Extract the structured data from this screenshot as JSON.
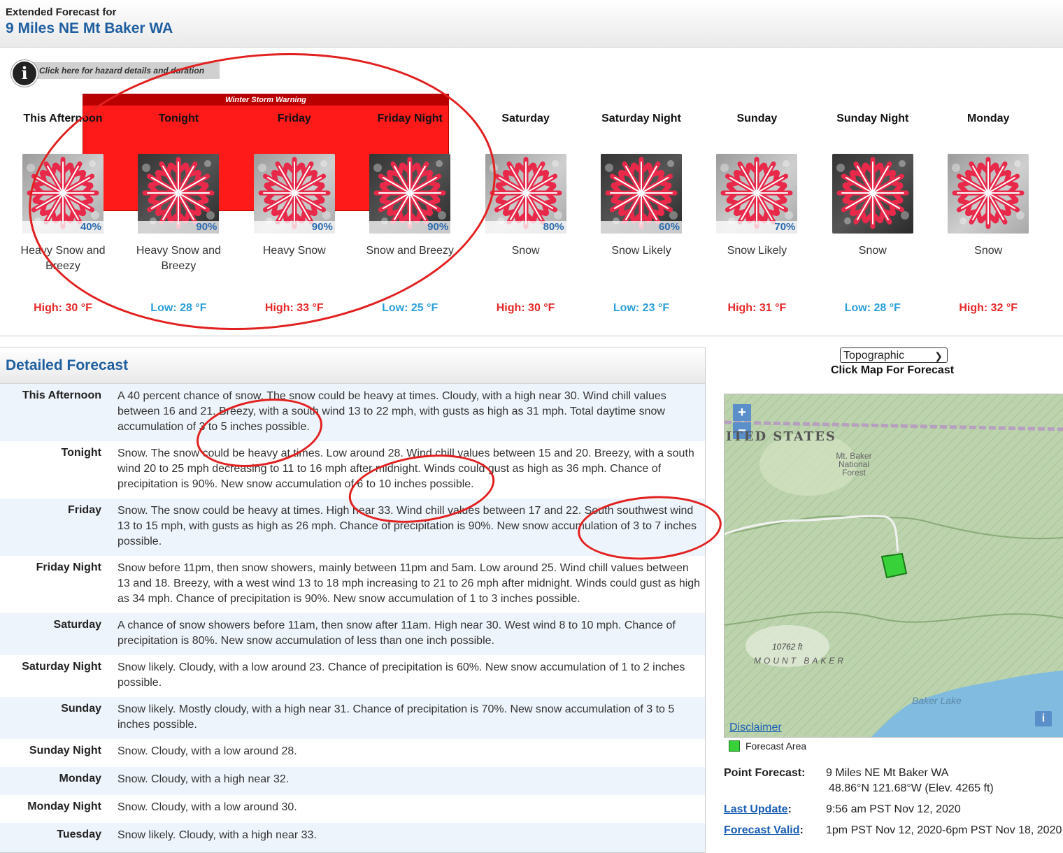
{
  "header": {
    "line1": "Extended Forecast for",
    "line2": "9 Miles NE Mt Baker WA"
  },
  "hazard": {
    "label": "Click here for hazard details and duration",
    "icon": "info-icon",
    "warning": "Winter Storm Warning",
    "warning_color": "#ff1a1a"
  },
  "periods": [
    {
      "name": "This Afternoon",
      "pop": "40%",
      "short": "Heavy Snow and Breezy",
      "temp": "High: 30 °F",
      "kind": "high",
      "dark": false
    },
    {
      "name": "Tonight",
      "pop": "90%",
      "short": "Heavy Snow and Breezy",
      "temp": "Low: 28 °F",
      "kind": "low",
      "dark": true
    },
    {
      "name": "Friday",
      "pop": "90%",
      "short": "Heavy Snow",
      "temp": "High: 33 °F",
      "kind": "high",
      "dark": false
    },
    {
      "name": "Friday Night",
      "pop": "90%",
      "short": "Snow and Breezy",
      "temp": "Low: 25 °F",
      "kind": "low",
      "dark": true
    },
    {
      "name": "Saturday",
      "pop": "80%",
      "short": "Snow",
      "temp": "High: 30 °F",
      "kind": "high",
      "dark": false
    },
    {
      "name": "Saturday Night",
      "pop": "60%",
      "short": "Snow Likely",
      "temp": "Low: 23 °F",
      "kind": "low",
      "dark": true
    },
    {
      "name": "Sunday",
      "pop": "70%",
      "short": "Snow Likely",
      "temp": "High: 31 °F",
      "kind": "high",
      "dark": false
    },
    {
      "name": "Sunday Night",
      "pop": "",
      "short": "Snow",
      "temp": "Low: 28 °F",
      "kind": "low",
      "dark": true
    },
    {
      "name": "Monday",
      "pop": "",
      "short": "Snow",
      "temp": "High: 32 °F",
      "kind": "high",
      "dark": false
    }
  ],
  "detailed": {
    "title": "Detailed Forecast",
    "rows": [
      {
        "label": "This Afternoon",
        "text": "A 40 percent chance of snow. The snow could be heavy at times. Cloudy, with a high near 30. Wind chill values between 16 and 21. Breezy, with a south wind 13 to 22 mph, with gusts as high as 31 mph. Total daytime snow accumulation of 3 to 5 inches possible."
      },
      {
        "label": "Tonight",
        "text": "Snow. The snow could be heavy at times. Low around 28. Wind chill values between 15 and 20. Breezy, with a south wind 20 to 25 mph decreasing to 11 to 16 mph after midnight. Winds could gust as high as 36 mph. Chance of precipitation is 90%. New snow accumulation of 6 to 10 inches possible."
      },
      {
        "label": "Friday",
        "text": "Snow. The snow could be heavy at times. High near 33. Wind chill values between 17 and 22. South southwest wind 13 to 15 mph, with gusts as high as 26 mph. Chance of precipitation is 90%. New snow accumulation of 3 to 7 inches possible."
      },
      {
        "label": "Friday Night",
        "text": "Snow before 11pm, then snow showers, mainly between 11pm and 5am. Low around 25. Wind chill values between 13 and 18. Breezy, with a west wind 13 to 18 mph increasing to 21 to 26 mph after midnight. Winds could gust as high as 34 mph. Chance of precipitation is 90%. New snow accumulation of 1 to 3 inches possible."
      },
      {
        "label": "Saturday",
        "text": "A chance of snow showers before 11am, then snow after 11am. High near 30. West wind 8 to 10 mph. Chance of precipitation is 80%. New snow accumulation of less than one inch possible."
      },
      {
        "label": "Saturday Night",
        "text": "Snow likely. Cloudy, with a low around 23. Chance of precipitation is 60%. New snow accumulation of 1 to 2 inches possible."
      },
      {
        "label": "Sunday",
        "text": "Snow likely. Mostly cloudy, with a high near 31. Chance of precipitation is 70%. New snow accumulation of 3 to 5 inches possible."
      },
      {
        "label": "Sunday Night",
        "text": "Snow. Cloudy, with a low around 28."
      },
      {
        "label": "Monday",
        "text": "Snow. Cloudy, with a high near 32."
      },
      {
        "label": "Monday Night",
        "text": "Snow. Cloudy, with a low around 30."
      },
      {
        "label": "Tuesday",
        "text": "Snow likely. Cloudy, with a high near 33."
      }
    ]
  },
  "map": {
    "select_value": "Topographic",
    "click_label": "Click Map For Forecast",
    "zoom_in": "+",
    "zoom_out": "−",
    "labels": {
      "country": "ITED STATES",
      "forest": "Mt. Baker National Forest",
      "elev": "10762 ft",
      "mountain": "MOUNT BAKER",
      "lake": "Baker Lake"
    },
    "disclaimer": "Disclaimer",
    "info": "i",
    "legend": "Forecast Area"
  },
  "point": {
    "pf_label": "Point Forecast:",
    "pf_value": "9 Miles NE Mt Baker WA",
    "coords": "48.86°N 121.68°W (Elev. 4265 ft)",
    "lu_label": "Last Update",
    "lu_value": "9:56 am PST Nov 12, 2020",
    "fv_label": "Forecast Valid",
    "fv_value": "1pm PST Nov 12, 2020-6pm PST Nov 18, 2020",
    "colon": ":"
  }
}
